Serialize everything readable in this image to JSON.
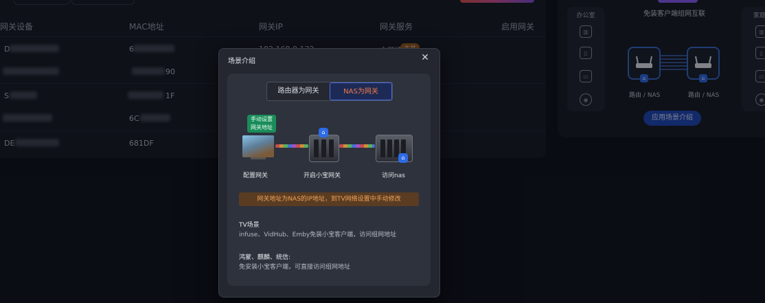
{
  "table": {
    "headers": {
      "device": "网关设备",
      "mac": "MAC地址",
      "ip": "网关IP",
      "service": "网关服务",
      "enable": "启用网关"
    },
    "rows": [
      {
        "device": "D",
        "mac": "6",
        "ip": "192.168.0.132",
        "service": "未开通",
        "tag": "去开"
      },
      {
        "device": "",
        "mac": "90",
        "ip": "",
        "service": ""
      },
      {
        "device": "S",
        "mac": "1F",
        "ip": "",
        "service": ""
      },
      {
        "device": "",
        "mac": "6C",
        "ip": "",
        "service": ""
      },
      {
        "device": "DE",
        "mac": "681DF",
        "ip": "",
        "service": ""
      }
    ]
  },
  "diagram": {
    "subtitle": "免装客户端组网互联",
    "zone_left": "办公室",
    "zone_right": "家庭",
    "router1_label": "路由 / NAS",
    "router2_label": "路由 / NAS",
    "button_label": "应用场景介绍",
    "accent": "#8b5cf6"
  },
  "modal": {
    "title": "场景介绍",
    "close_symbol": "✕",
    "tabs": [
      "路由器为网关",
      "NAS为网关"
    ],
    "active_tab": "NAS为网关",
    "hint_tag": [
      "手动设置",
      "网关地址"
    ],
    "steps": [
      "配置网关",
      "开启小宝网关",
      "访问nas"
    ],
    "info": "网关地址为NAS的IP地址，到TV网络设置中手动修改",
    "sections": [
      {
        "title": "TV场景",
        "text": "infuse、VidHub、Emby免装小宝客户端，访问组网地址"
      },
      {
        "title": "鸿蒙、麒麟、统信:",
        "text": "免安装小宝客户端，可直接访问组网地址"
      }
    ],
    "colors": {
      "active_tab_text": "#f07b4a",
      "info_bg": "#5a3c22",
      "info_text": "#f0a35a",
      "badge": "#2e6be6"
    }
  }
}
